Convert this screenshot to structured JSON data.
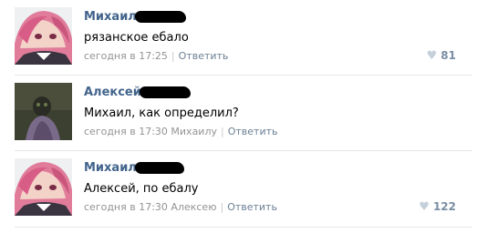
{
  "comments": [
    {
      "author": "Михаил",
      "text": "рязанское ебало",
      "time": "сегодня в 17:25",
      "reply_to": "",
      "reply_label": "Ответить",
      "likes": "81",
      "avatar_icon": "anime-avatar-icon"
    },
    {
      "author": "Алексей",
      "text": "Михаил, как определил?",
      "time": "сегодня в 17:30",
      "reply_to": "Михаилу",
      "reply_label": "Ответить",
      "likes": "",
      "avatar_icon": "dark-avatar-icon"
    },
    {
      "author": "Михаил",
      "text": "Алексей, по ебалу",
      "time": "сегодня в 17:30",
      "reply_to": "Алексею",
      "reply_label": "Ответить",
      "likes": "122",
      "avatar_icon": "anime-avatar-icon"
    }
  ],
  "colors": {
    "author": "#42648b",
    "meta": "#939393",
    "like_heart": "#c6d0db",
    "divider": "#e4e7ea"
  }
}
